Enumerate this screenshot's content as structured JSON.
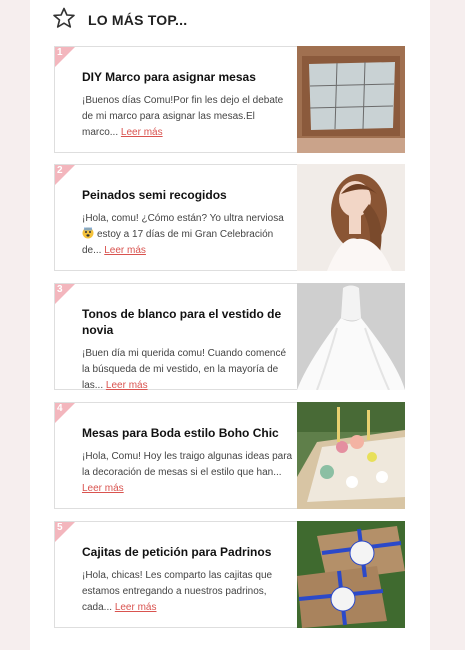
{
  "section": {
    "title": "LO MÁS TOP...",
    "icon": "star-icon"
  },
  "colors": {
    "accent": "#d9534f",
    "rank_badge": "#f3b6bd"
  },
  "items": [
    {
      "rank": "1",
      "title": "DIY Marco para asignar mesas",
      "excerpt_lines": [
        "¡Buenos días Comu!Por fin les dejo el debate",
        "de mi marco para asignar las mesas.El",
        "marco..."
      ],
      "read_more": "Leer más",
      "thumb": "table-frame-image"
    },
    {
      "rank": "2",
      "title": "Peinados semi recogidos",
      "excerpt_lines": [
        "¡Hola, comu! ¿Cómo están? Yo ultra nerviosa",
        "estoy a 17 días de mi Gran Celebración",
        "de..."
      ],
      "read_more": "Leer más",
      "thumb": "bride-hairstyle-image",
      "emoji": "nervous-face-emoji"
    },
    {
      "rank": "3",
      "title": "Tonos de blanco para el vestido de novia",
      "excerpt_lines": [
        "¡Buen día mi querida comu! Cuando comencé",
        "la búsqueda de mi vestido, en la mayoría de",
        "las..."
      ],
      "read_more": "Leer más",
      "thumb": "wedding-dress-image"
    },
    {
      "rank": "4",
      "title": "Mesas para Boda estilo Boho Chic",
      "excerpt_lines": [
        "¡Hola, Comu! Hoy les traigo algunas ideas para",
        "la decoración de mesas si el estilo que han...",
        ""
      ],
      "read_more": "Leer más",
      "thumb": "boho-table-image"
    },
    {
      "rank": "5",
      "title": "Cajitas de petición para Padrinos",
      "excerpt_lines": [
        "¡Hola, chicas! Les comparto las cajitas que",
        "estamos entregando a nuestros padrinos,",
        "cada..."
      ],
      "read_more": "Leer más",
      "thumb": "gift-boxes-image"
    }
  ]
}
